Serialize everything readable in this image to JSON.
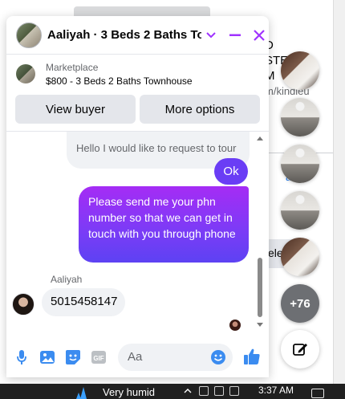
{
  "chat": {
    "title": "Aaliyah · 3 Beds 2 Baths To...",
    "icons": {
      "chevron": "chevron-down-icon",
      "minimize": "minimize-icon",
      "close": "close-icon"
    },
    "marketplace": {
      "label": "Marketplace",
      "title": "$800 - 3 Beds 2 Baths Townhouse"
    },
    "actions": {
      "view_buyer": "View buyer",
      "more_options": "More options"
    },
    "messages": {
      "sent_partial": "Hello I would like to request to tour",
      "sent_ok": "Ok",
      "sent_long": "Please send me your phn number so that we can get in touch with you through phone",
      "received_sender": "Aaliyah",
      "received_text": "5015458147"
    },
    "composer": {
      "placeholder": "Aa"
    },
    "accent_color": "#a033ff",
    "bubble_gradient": [
      "#a52cf5",
      "#5d42f3"
    ]
  },
  "chat_heads": {
    "overflow_count": "+76"
  },
  "background": {
    "line1": "D",
    "line2": "STE",
    "line3": "M",
    "link_fragment": "m/kindleu",
    "blue_fragment": "all",
    "button_fragment": "ele"
  },
  "taskbar": {
    "weather": "Very humid",
    "time": "3:37 AM"
  }
}
